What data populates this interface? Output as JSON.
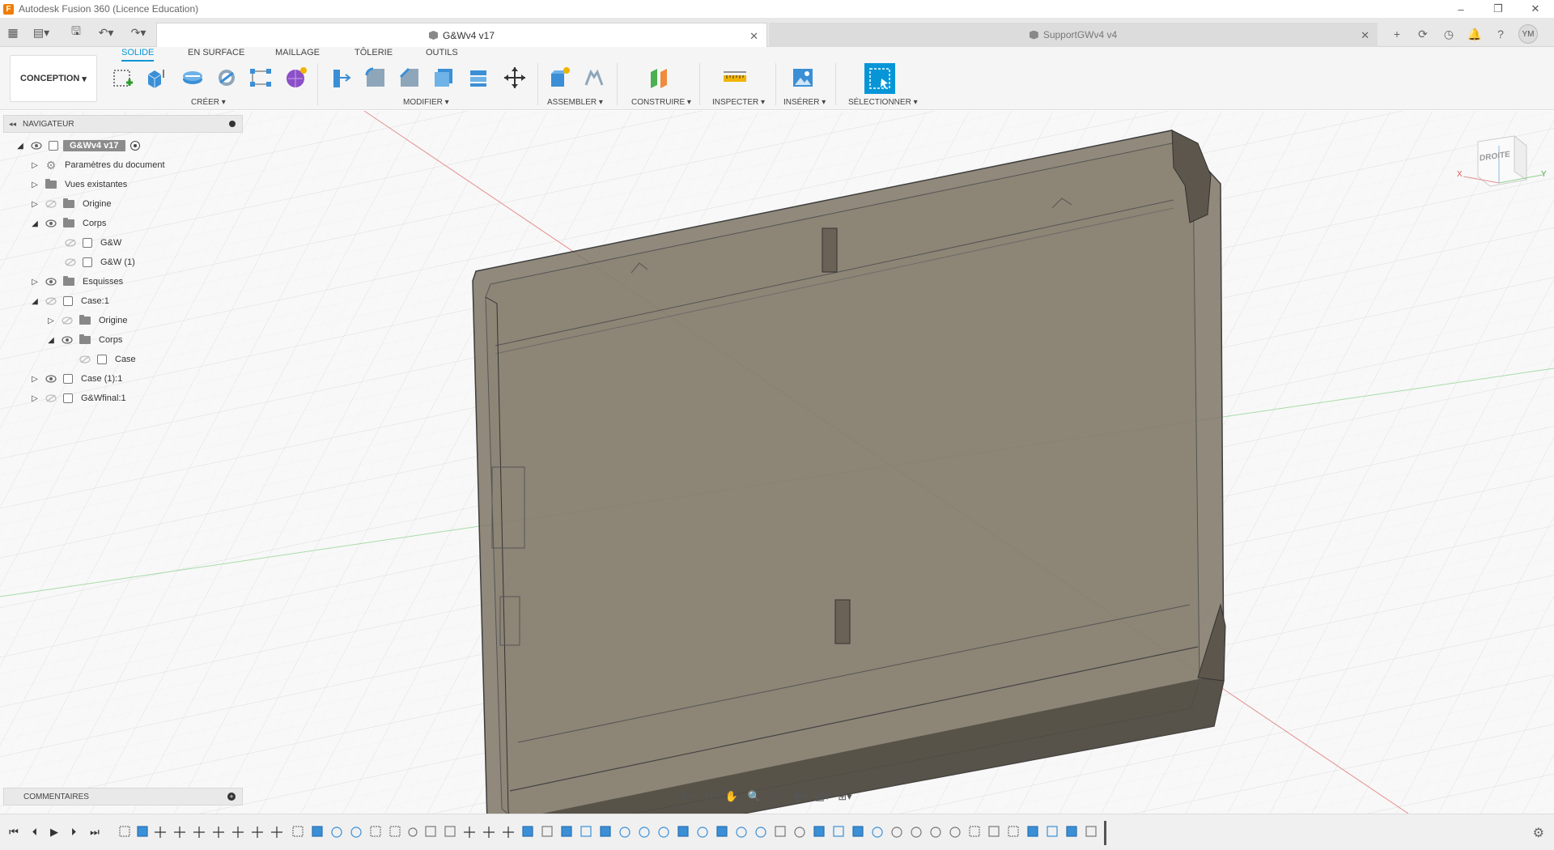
{
  "window": {
    "title": "Autodesk Fusion 360 (Licence Education)",
    "logo_letter": "F"
  },
  "tabs": {
    "active": "G&Wv4 v17",
    "inactive": "SupportGWv4 v4",
    "user_initials": "YM"
  },
  "ribbon": {
    "workspace": "CONCEPTION",
    "tabs": [
      "SOLIDE",
      "EN SURFACE",
      "MAILLAGE",
      "TÔLERIE",
      "OUTILS"
    ],
    "groups": {
      "create": "CRÉER",
      "modify": "MODIFIER",
      "assemble": "ASSEMBLER",
      "construct": "CONSTRUIRE",
      "inspect": "INSPECTER",
      "insert": "INSÉRER",
      "select": "SÉLECTIONNER"
    }
  },
  "navigator": {
    "title": "NAVIGATEUR",
    "root": "G&Wv4 v17",
    "items": [
      {
        "label": "Paramètres du document"
      },
      {
        "label": "Vues existantes"
      },
      {
        "label": "Origine"
      },
      {
        "label": "Corps"
      },
      {
        "label": "G&W"
      },
      {
        "label": "G&W (1)"
      },
      {
        "label": "Esquisses"
      },
      {
        "label": "Case:1"
      },
      {
        "label": "Origine"
      },
      {
        "label": "Corps"
      },
      {
        "label": "Case"
      },
      {
        "label": "Case (1):1"
      },
      {
        "label": "G&Wfinal:1"
      }
    ]
  },
  "viewcube": {
    "face": "DROITE",
    "axis_x": "X",
    "axis_y": "Y"
  },
  "comments": {
    "title": "COMMENTAIRES"
  },
  "colors": {
    "accent": "#0696d7",
    "model_fill": "#837a6c",
    "model_edge": "#4a4a4a"
  }
}
